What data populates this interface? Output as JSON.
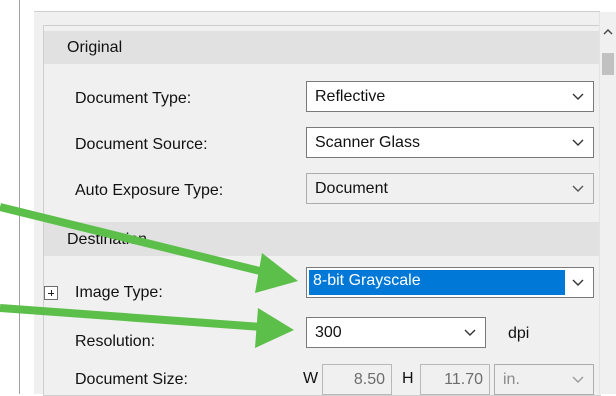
{
  "original_section": {
    "title": "Original",
    "document_type": {
      "label": "Document Type:",
      "value": "Reflective"
    },
    "document_source": {
      "label": "Document Source:",
      "value": "Scanner Glass"
    },
    "auto_exposure_type": {
      "label": "Auto Exposure Type:",
      "value": "Document"
    }
  },
  "destination_section": {
    "title": "Destination",
    "image_type": {
      "label": "Image Type:",
      "value": "8-bit Grayscale"
    },
    "resolution": {
      "label": "Resolution:",
      "value": "300",
      "unit": "dpi"
    },
    "document_size": {
      "label": "Document Size:",
      "width_prefix": "W",
      "width": "8.50",
      "height_prefix": "H",
      "height": "11.70",
      "unit": "in."
    }
  },
  "colors": {
    "annotation_arrow": "#5bbf4a",
    "selection": "#0078d7"
  },
  "icons": [
    "chevron-down-icon",
    "expand-plus-icon",
    "scroll-up-arrow-icon"
  ]
}
